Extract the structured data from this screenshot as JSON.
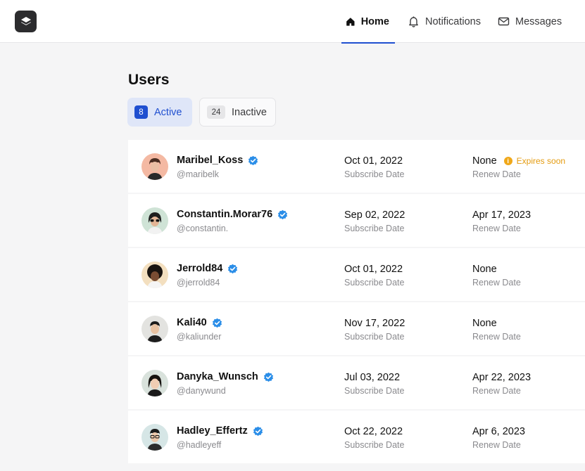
{
  "nav": {
    "home": "Home",
    "notifications": "Notifications",
    "messages": "Messages"
  },
  "page": {
    "title": "Users"
  },
  "tabs": {
    "active": {
      "count": "8",
      "label": "Active"
    },
    "inactive": {
      "count": "24",
      "label": "Inactive"
    }
  },
  "labels": {
    "subscribe": "Subscribe Date",
    "renew": "Renew Date",
    "expires": "Expires soon"
  },
  "colors": {
    "accent": "#1f4fd0",
    "verified": "#2b8ee8",
    "warning": "#e49b0f"
  },
  "users": [
    {
      "name": "Maribel_Koss",
      "handle": "@maribelk",
      "subscribe": "Oct 01, 2022",
      "renew": "None",
      "expires_soon": true
    },
    {
      "name": "Constantin.Morar76",
      "handle": "@constantin.",
      "subscribe": "Sep 02, 2022",
      "renew": "Apr 17, 2023"
    },
    {
      "name": "Jerrold84",
      "handle": "@jerrold84",
      "subscribe": "Oct 01, 2022",
      "renew": "None"
    },
    {
      "name": "Kali40",
      "handle": "@kaliunder",
      "subscribe": "Nov 17, 2022",
      "renew": "None"
    },
    {
      "name": "Danyka_Wunsch",
      "handle": "@danywund",
      "subscribe": "Jul 03, 2022",
      "renew": "Apr 22, 2023"
    },
    {
      "name": "Hadley_Effertz",
      "handle": "@hadleyeff",
      "subscribe": "Oct 22, 2022",
      "renew": "Apr 6, 2023"
    }
  ]
}
